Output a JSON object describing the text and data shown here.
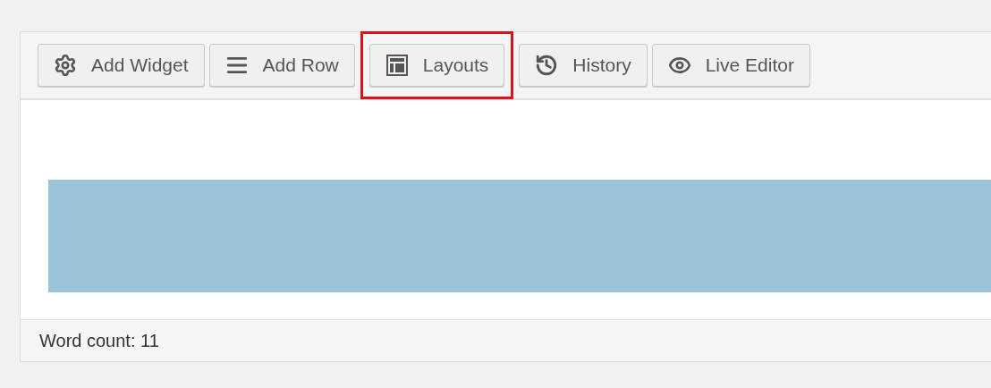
{
  "toolbar": {
    "buttons": [
      {
        "kind": "widget",
        "label": "Add Widget",
        "highlighted": false
      },
      {
        "kind": "row",
        "label": "Add Row",
        "highlighted": false
      },
      {
        "kind": "layouts",
        "label": "Layouts",
        "highlighted": true
      },
      {
        "kind": "history",
        "label": "History",
        "highlighted": false
      },
      {
        "kind": "live",
        "label": "Live Editor",
        "highlighted": false
      }
    ]
  },
  "footer": {
    "word_count": "Word count: 11"
  }
}
